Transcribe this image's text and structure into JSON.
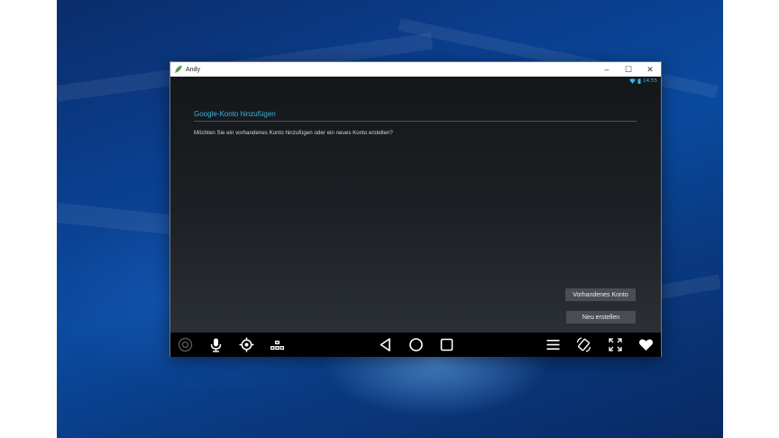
{
  "window": {
    "title": "Andy",
    "minimize_glyph": "–",
    "maximize_glyph": "☐",
    "close_glyph": "✕"
  },
  "statusbar": {
    "time": "14:55",
    "icons": [
      "wifi-icon",
      "battery-icon"
    ]
  },
  "dialog": {
    "title": "Google-Konto hinzufügen",
    "message": "Möchten Sie ein vorhandenes Konto hinzufügen oder ein neues Konto erstellen?",
    "buttons": {
      "existing": "Vorhandenes Konto",
      "create": "Neu erstellen"
    }
  },
  "navbar": {
    "left_icons": [
      "andy-settings-icon",
      "microphone-icon",
      "location-target-icon",
      "gamepad-icon"
    ],
    "center_icons": [
      "back-icon",
      "home-icon",
      "recent-apps-icon"
    ],
    "right_icons": [
      "menu-icon",
      "rotate-screen-icon",
      "fullscreen-icon",
      "heart-icon"
    ]
  },
  "colors": {
    "accent": "#33b5e5",
    "desktop_blue": "#0b3f8f",
    "window_bg": "#1e2124",
    "button_bg": "#4a4e53"
  }
}
